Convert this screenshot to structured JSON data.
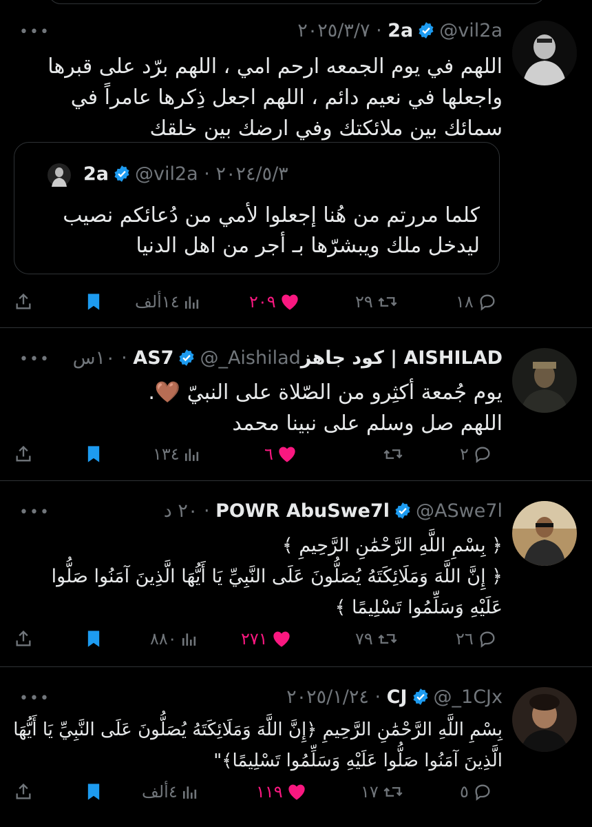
{
  "tweets": [
    {
      "name": "2a",
      "meta": "@vil2a · ٢٠٢٥/٣/٧",
      "lines": [
        "اللهم في يوم الجمعه ارحم امي ، اللهم برّد على قبرها",
        "واجعلها في نعيم دائم ، اللهم اجعل ذِكرها عامراً في",
        "سمائك بين ملائكتك وفي ارضك بين خلقك"
      ],
      "quote": {
        "name": "2a",
        "meta": "@vil2a · ٢٠٢٤/٥/٣",
        "lines": [
          "كلما مررتم من هُنا إجعلوا لأمي من دُعائكم نصيب",
          "ليدخل ملك ويبشرّها بـ أجر من اهل الدنيا"
        ]
      },
      "replies": "١٨",
      "retweets": "٢٩",
      "likes": "٢٠٩",
      "views": "١٤ألف"
    },
    {
      "name": "AISHILAD | كود جاهزAS7",
      "meta": "@_Aishilad · ١٠س",
      "lines": [
        "يوم جُمعة أكثِرو من الصّلاة على النبيّ 🤎.",
        "اللهم صل وسلم على نبينا محمد"
      ],
      "replies": "٢",
      "retweets": "",
      "likes": "٦",
      "views": "١٣٤"
    },
    {
      "name": "POWR AbuSwe7l",
      "meta": "@ASwe7l · ٢٠ د",
      "lines": [
        "﴿ بِسْمِ اللَّهِ الرَّحْمَٰنِ الرَّحِيمِ ﴾",
        "﴿ إِنَّ اللَّهَ وَمَلَائِكَتَهُ يُصَلُّونَ عَلَى النَّبِيِّ يَا أَيُّهَا الَّذِينَ آمَنُوا صَلُّوا",
        "عَلَيْهِ وَسَلِّمُوا تَسْلِيمًا ﴾"
      ],
      "replies": "٢٦",
      "retweets": "٧٩",
      "likes": "٢٧١",
      "views": "٨٨٠"
    },
    {
      "name": "CJ",
      "meta": "@_1CJx · ٢٠٢٥/١/٢٤",
      "lines": [
        "بِسْمِ اللَّهِ الرَّحْمَٰنِ الرَّحِيمِ ﴿إِنَّ اللَّهَ وَمَلَائِكَتَهُ يُصَلُّونَ عَلَى النَّبِيِّ يَا أَيُّهَا",
        "الَّذِينَ آمَنُوا صَلُّوا عَلَيْهِ وَسَلِّمُوا تَسْلِيمًا﴾\""
      ],
      "replies": "٥",
      "retweets": "١٧",
      "likes": "١١٩",
      "views": "٤ألف"
    }
  ],
  "more_label": "•••",
  "colors": {
    "accent": "#1d9bf0",
    "like": "#f91880",
    "muted": "#71767b",
    "text": "#e7e9ea",
    "border": "#2f3336"
  },
  "icons": [
    "reply-icon",
    "retweet-icon",
    "like-icon",
    "views-icon",
    "bookmark-icon",
    "share-icon",
    "verified-badge-icon"
  ]
}
